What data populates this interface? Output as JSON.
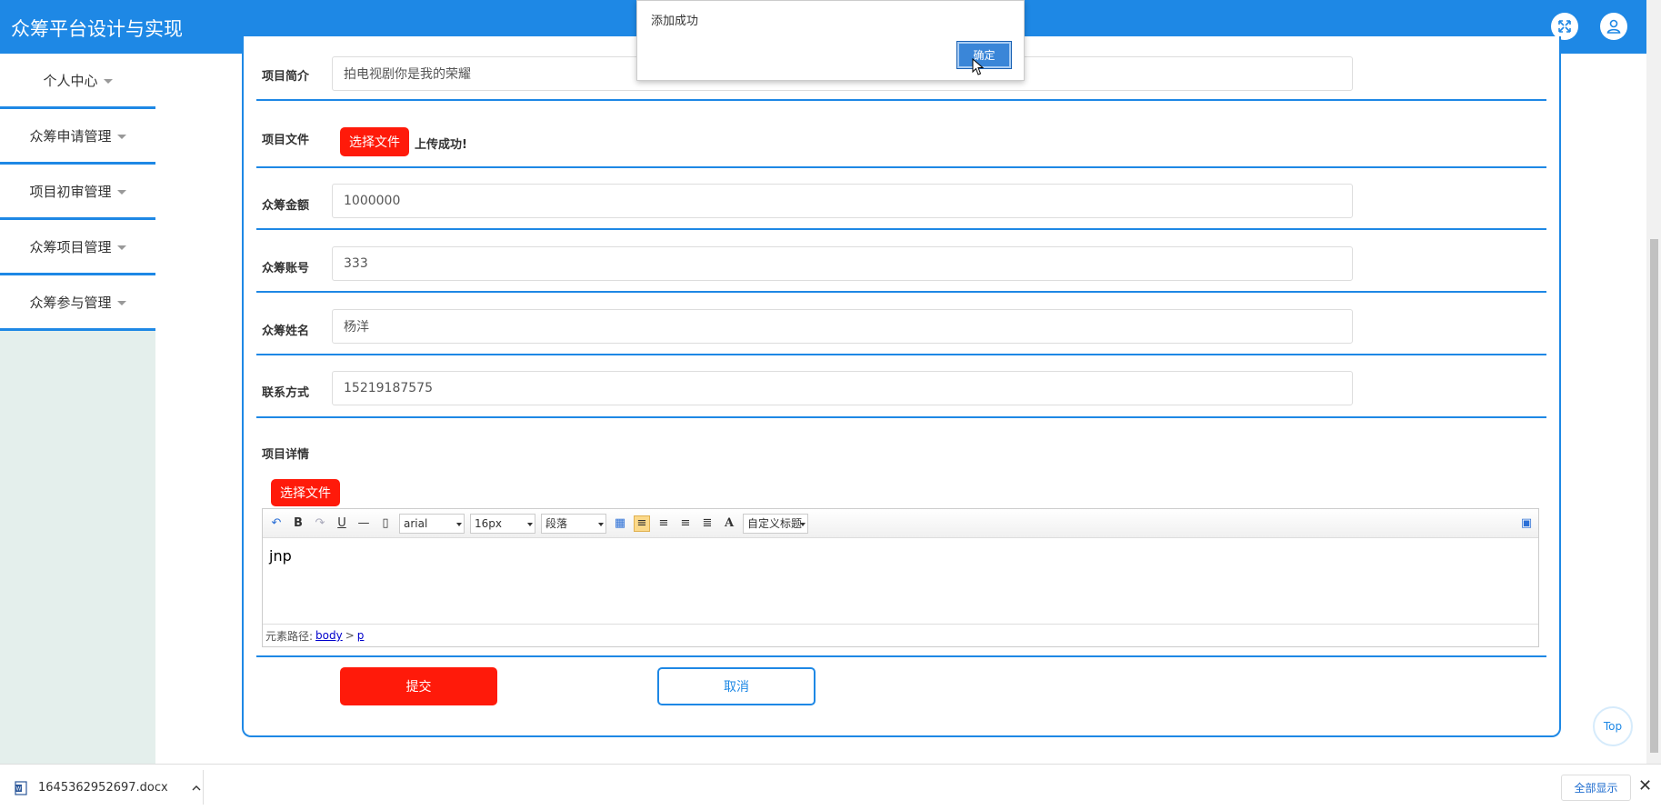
{
  "header": {
    "title": "众筹平台设计与实现"
  },
  "sidebar": {
    "items": [
      {
        "label": "个人中心"
      },
      {
        "label": "众筹申请管理"
      },
      {
        "label": "项目初审管理"
      },
      {
        "label": "众筹项目管理"
      },
      {
        "label": "众筹参与管理"
      }
    ]
  },
  "form": {
    "intro": {
      "label": "项目简介",
      "value": "拍电视剧你是我的荣耀"
    },
    "file": {
      "label": "项目文件",
      "button": "选择文件",
      "status": "上传成功!"
    },
    "amount": {
      "label": "众筹金额",
      "value": "1000000"
    },
    "account": {
      "label": "众筹账号",
      "value": "333"
    },
    "name": {
      "label": "众筹姓名",
      "value": "杨洋"
    },
    "contact": {
      "label": "联系方式",
      "value": "15219187575"
    },
    "detail": {
      "label": "项目详情",
      "button": "选择文件"
    },
    "submit": "提交",
    "cancel": "取消"
  },
  "editor": {
    "font": "arial",
    "size": "16px",
    "paragraph": "段落",
    "custom_title": "自定义标题",
    "content": "jnp",
    "path_label": "元素路径:",
    "path_body": "body",
    "path_sep": ">",
    "path_p": "p"
  },
  "alert": {
    "message": "添加成功",
    "ok": "确定"
  },
  "top_button": "Top",
  "download": {
    "filename": "1645362952697.docx",
    "show_all": "全部显示"
  }
}
